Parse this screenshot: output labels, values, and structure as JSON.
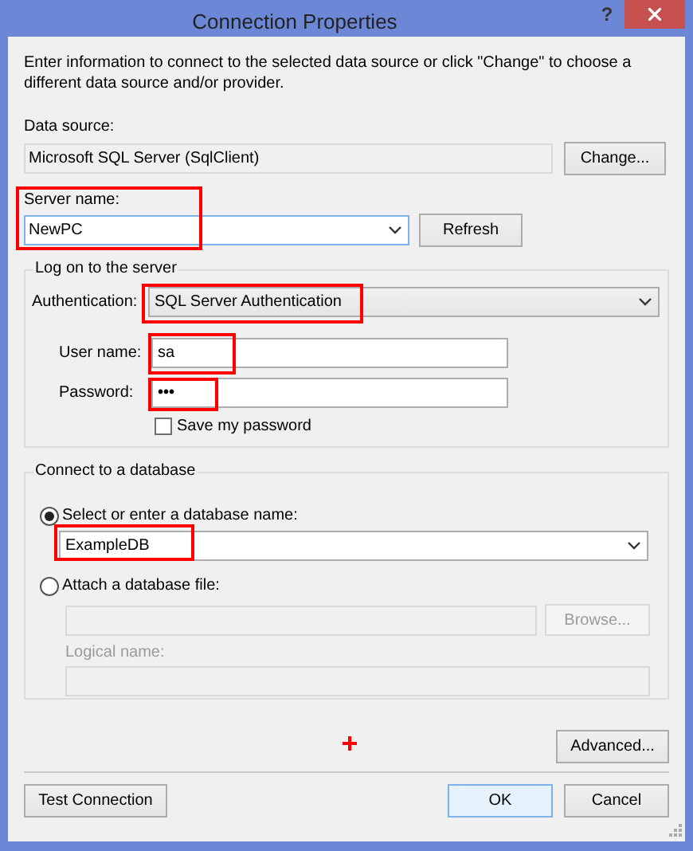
{
  "window": {
    "title": "Connection Properties",
    "help": "?"
  },
  "intro": "Enter information to connect to the selected data source or click \"Change\" to choose a different data source and/or provider.",
  "data_source": {
    "label": "Data source:",
    "value": "Microsoft SQL Server (SqlClient)",
    "button": "Change..."
  },
  "server": {
    "label": "Server name:",
    "value": "NewPC",
    "button": "Refresh"
  },
  "logon": {
    "title": "Log on to the server",
    "authentication": {
      "label": "Authentication:",
      "value": "SQL Server Authentication"
    },
    "user": {
      "label": "User name:",
      "value": "sa"
    },
    "password": {
      "label": "Password:",
      "value": "•••"
    },
    "save_password": {
      "label": "Save my password",
      "checked": false
    }
  },
  "database": {
    "title": "Connect to a database",
    "options": [
      {
        "label": "Select or enter a database name:",
        "selected": true
      },
      {
        "label": "Attach a database file:",
        "selected": false
      }
    ],
    "name_value": "ExampleDB",
    "browse": {
      "label": "Browse...",
      "disabled": true
    },
    "logical_name": {
      "label": "Logical name:",
      "disabled": true
    }
  },
  "advanced": "Advanced...",
  "buttons": [
    {
      "label": "Test Connection",
      "default": false
    },
    {
      "label": "OK",
      "default": true
    },
    {
      "label": "Cancel",
      "default": false
    }
  ]
}
